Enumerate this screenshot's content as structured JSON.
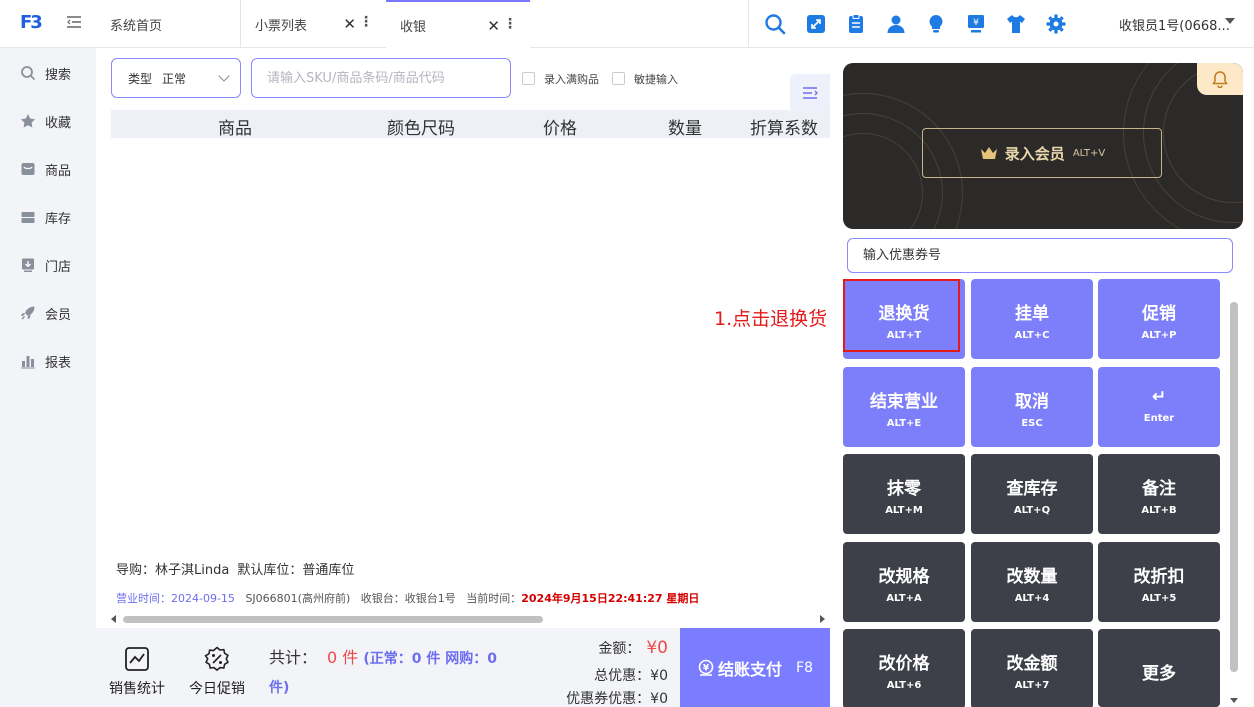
{
  "header": {
    "logo": "F3",
    "tabs": [
      {
        "label": "系统首页"
      },
      {
        "label": "小票列表"
      },
      {
        "label": "收银"
      }
    ],
    "user": "收银员1号(0668..."
  },
  "sidebar": {
    "items": [
      {
        "label": "搜索",
        "icon": "search-icon"
      },
      {
        "label": "收藏",
        "icon": "star-icon"
      },
      {
        "label": "商品",
        "icon": "goods-icon"
      },
      {
        "label": "库存",
        "icon": "inventory-icon"
      },
      {
        "label": "门店",
        "icon": "store-icon"
      },
      {
        "label": "会员",
        "icon": "rocket-icon"
      },
      {
        "label": "报表",
        "icon": "report-icon"
      }
    ]
  },
  "main": {
    "type_label": "类型",
    "type_value": "正常",
    "sku_placeholder": "请输入SKU/商品条码/商品代码",
    "checkbox_full_gift": "录入满购品",
    "checkbox_quick_input": "敏捷输入",
    "columns": [
      "商品",
      "颜色尺码",
      "价格",
      "数量",
      "折算系数"
    ],
    "guide": "导购：林子淇Linda",
    "default_location": "默认库位：普通库位",
    "business_time_label": "营业时间：",
    "business_time": "2024-09-15",
    "store": "SJ066801(高州府前)",
    "register": "收银台：收银台1号",
    "current_time_label": "当前时间：",
    "current_time": "2024年9月15日22:41:27 星期日"
  },
  "footer": {
    "sales_stats": "销售统计",
    "today_promo": "今日促销",
    "total_label": "共计：",
    "total_count": "0 件",
    "total_detail": "(正常：0 件  网购：0",
    "total_detail_end": "件)",
    "amount_label": "金额：",
    "amount": "¥0",
    "discount_label": "总优惠：",
    "discount": "¥0",
    "coupon_discount_label": "优惠券优惠：",
    "coupon_discount": "¥0",
    "checkout_label": "结账支付",
    "checkout_hotkey": "F8"
  },
  "right_panel": {
    "member_label": "录入会员",
    "member_hotkey": "ALT+V",
    "coupon_placeholder": "输入优惠券号",
    "buttons": [
      {
        "label": "退换货",
        "hotkey": "ALT+T",
        "style": "purple"
      },
      {
        "label": "挂单",
        "hotkey": "ALT+C",
        "style": "purple"
      },
      {
        "label": "促销",
        "hotkey": "ALT+P",
        "style": "purple"
      },
      {
        "label": "结束营业",
        "hotkey": "ALT+E",
        "style": "purple"
      },
      {
        "label": "取消",
        "hotkey": "ESC",
        "style": "purple"
      },
      {
        "label": "↵",
        "hotkey": "Enter",
        "style": "purple"
      },
      {
        "label": "抹零",
        "hotkey": "ALT+M",
        "style": "dark"
      },
      {
        "label": "查库存",
        "hotkey": "ALT+Q",
        "style": "dark"
      },
      {
        "label": "备注",
        "hotkey": "ALT+B",
        "style": "dark"
      },
      {
        "label": "改规格",
        "hotkey": "ALT+A",
        "style": "dark"
      },
      {
        "label": "改数量",
        "hotkey": "ALT+4",
        "style": "dark"
      },
      {
        "label": "改折扣",
        "hotkey": "ALT+5",
        "style": "dark"
      },
      {
        "label": "改价格",
        "hotkey": "ALT+6",
        "style": "dark"
      },
      {
        "label": "改金额",
        "hotkey": "ALT+7",
        "style": "dark"
      },
      {
        "label": "更多",
        "hotkey": "",
        "style": "dark"
      }
    ]
  },
  "annotation": {
    "text": "1.点击退换货",
    "color": "#e21a1a"
  },
  "colors": {
    "accent": "#7a7dff",
    "dark_button": "#3d4049",
    "highlight_red": "#e21a1a"
  }
}
